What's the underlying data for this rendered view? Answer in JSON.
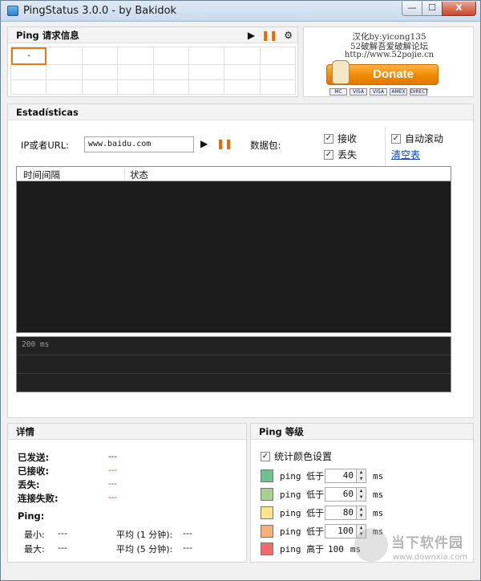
{
  "window": {
    "title": "PingStatus 3.0.0 - by Bakidok",
    "min": "—",
    "max": "☐",
    "close": "X"
  },
  "ping_panel": {
    "header": "Ping 请求信息",
    "first_cell": "-"
  },
  "donate": {
    "credit_line1": "汉化by:yicong135",
    "credit_line2": "52破解吾爱破解论坛",
    "credit_line3": "http://www.52pojie.cn",
    "button": "Donate",
    "cards": [
      "MC",
      "VISA",
      "VISA",
      "AMEX",
      "DIRECT"
    ]
  },
  "stats": {
    "header": "Estadísticas",
    "url_label": "IP或者URL:",
    "url_value": "www.baidu.com",
    "packet_label": "数据包:",
    "cb_received": "接收",
    "cb_lost": "丢失",
    "cb_autoscroll": "自动滚动",
    "clear_link": "清空表",
    "col_time": "时间间隔",
    "col_status": "状态",
    "graph_label": "200 ms"
  },
  "details": {
    "header": "详情",
    "sent": "已发送:",
    "sent_val": "---",
    "received": "已接收:",
    "received_val": "---",
    "lost": "丢失:",
    "lost_val": "---",
    "consec": "连接失败:",
    "consec_val": "---",
    "ping_label": "Ping:",
    "min": "最小:",
    "min_val": "---",
    "max": "最大:",
    "max_val": "---",
    "avg1": "平均 (1 分钟):",
    "avg1_val": "---",
    "avg5": "平均 (5 分钟):",
    "avg5_val": "---"
  },
  "level": {
    "header": "Ping 等级",
    "cb_color": "统计颜色设置",
    "rows": [
      {
        "text": "ping 低于",
        "value": "40",
        "unit": "ms",
        "color": "#6fc08a"
      },
      {
        "text": "ping 低于",
        "value": "60",
        "unit": "ms",
        "color": "#a9d08e"
      },
      {
        "text": "ping 低于",
        "value": "80",
        "unit": "ms",
        "color": "#ffe58a"
      },
      {
        "text": "ping 低于",
        "value": "100",
        "unit": "ms",
        "color": "#f7b07a"
      },
      {
        "text": "ping 高于",
        "value": "100",
        "unit": "ms",
        "color": "#f26b6b"
      }
    ]
  },
  "watermark": {
    "text": "当下软件园",
    "url": "www.downxia.com"
  }
}
